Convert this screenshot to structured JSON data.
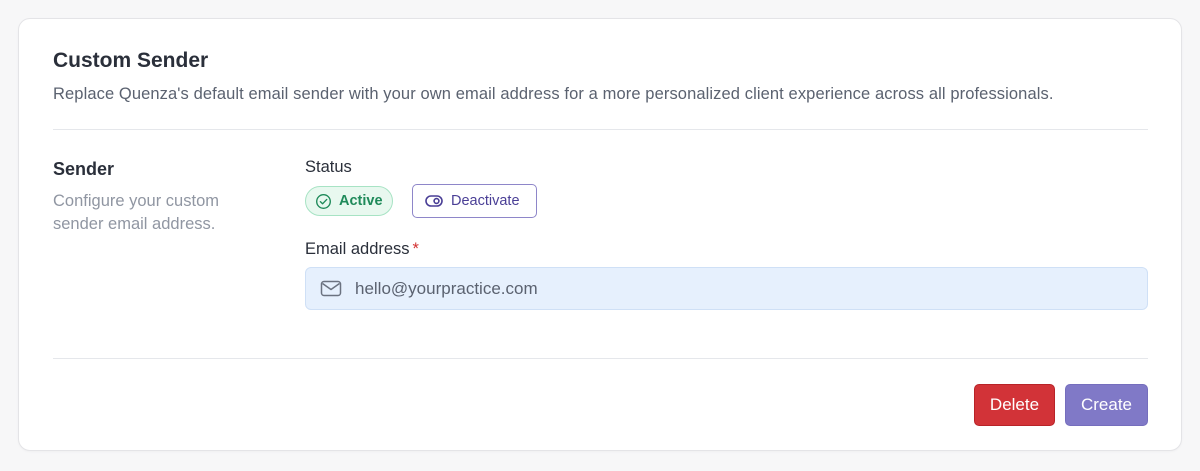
{
  "card": {
    "title": "Custom Sender",
    "description": "Replace Quenza's default email sender with your own email address for a more personalized client experience across all professionals."
  },
  "sender_section": {
    "title": "Sender",
    "description": "Configure your custom sender email address."
  },
  "status": {
    "label": "Status",
    "badge_text": "Active",
    "badge_icon": "check-circle-icon",
    "deactivate_label": "Deactivate",
    "deactivate_icon": "toggle-icon"
  },
  "email": {
    "label": "Email address",
    "required_mark": "*",
    "value": "hello@yourpractice.com",
    "icon": "envelope-icon"
  },
  "actions": {
    "delete_label": "Delete",
    "create_label": "Create"
  },
  "colors": {
    "active": "#1f8a5a",
    "accent": "#8079c7",
    "danger": "#d23338"
  }
}
